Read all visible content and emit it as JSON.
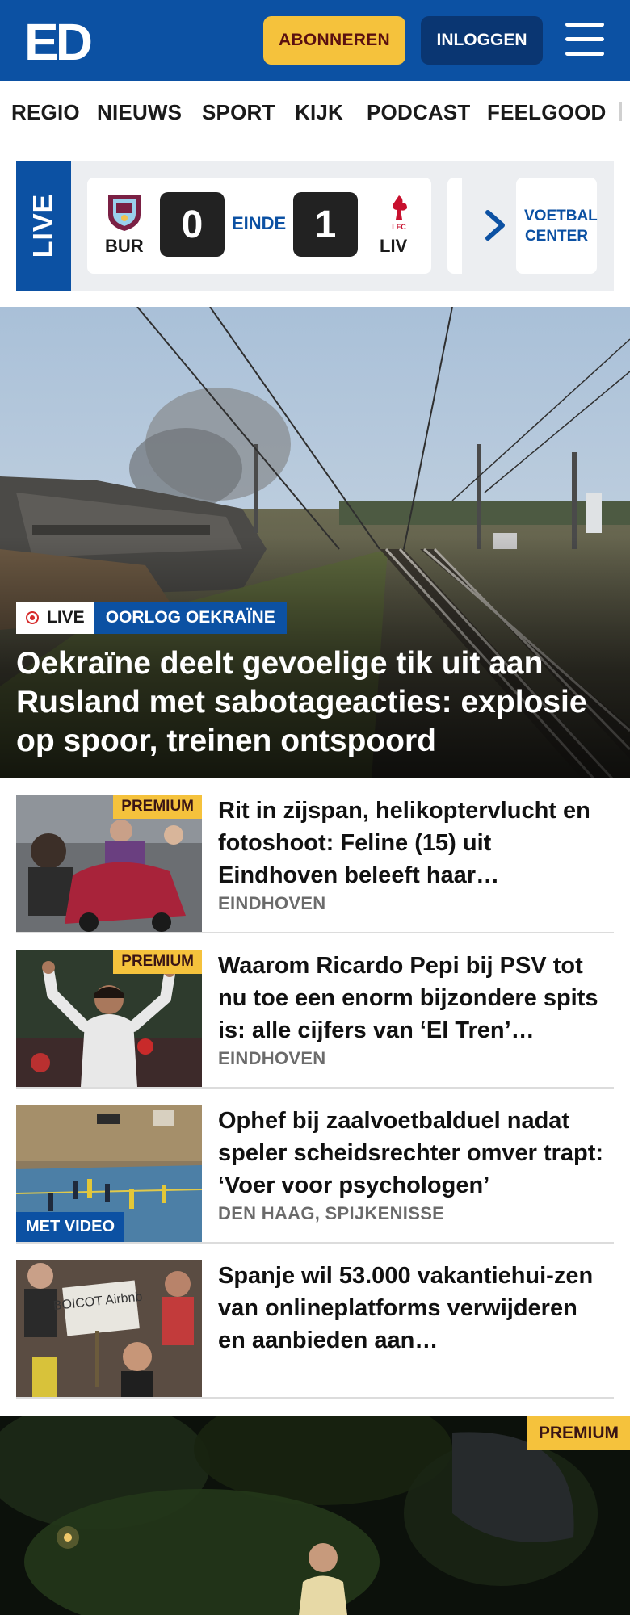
{
  "header": {
    "logo_text": "ED",
    "subscribe_label": "ABONNEREN",
    "login_label": "INLOGGEN",
    "menu_icon": "hamburger-menu-icon",
    "background": "#0c51a3",
    "accent": "#f5c23c"
  },
  "nav": {
    "items": [
      {
        "label": "REGIO"
      },
      {
        "label": "NIEUWS"
      },
      {
        "label": "SPORT"
      },
      {
        "label": "KIJK"
      },
      {
        "label": "PODCAST"
      },
      {
        "label": "FEELGOOD"
      }
    ]
  },
  "live_scores": {
    "badge": "LIVE",
    "match": {
      "home_team": "BUR",
      "home_score": "0",
      "status": "EINDE",
      "away_score": "1",
      "away_team": "LIV"
    },
    "next_icon": "chevron-right-icon",
    "voetbal_center_label": "VOETBAL CENTER"
  },
  "hero": {
    "live_tag": "LIVE",
    "topic_tag": "OORLOG OEKRAÏNE",
    "title": "Oekraïne deelt gevoelige tik uit aan Rusland met sabotageacties: explosie op spoor, treinen ontspoord"
  },
  "articles": [
    {
      "badge": "PREMIUM",
      "title": "Rit in zijspan, helikoptervlucht en fotoshoot: Feline (15) uit Eindhoven beleeft haar…",
      "meta": "EINDHOVEN"
    },
    {
      "badge": "PREMIUM",
      "title": "Waarom Ricardo Pepi bij PSV tot nu toe een enorm bijzondere spits is: alle cijfers van ‘El Tren’…",
      "meta": "EINDHOVEN"
    },
    {
      "badge": "MET VIDEO",
      "title": "Ophef bij zaalvoetbalduel nadat speler scheidsrechter omver trapt: ‘Voer voor psychologen’",
      "meta": "DEN HAAG, SPIJKENISSE"
    },
    {
      "title": "Spanje wil 53.000 vakantiehui-zen van onlineplatforms verwijderen en aanbieden aan…",
      "meta": "",
      "sign_text": "BOICOT Airbnb"
    }
  ],
  "feature": {
    "badge": "PREMIUM"
  }
}
